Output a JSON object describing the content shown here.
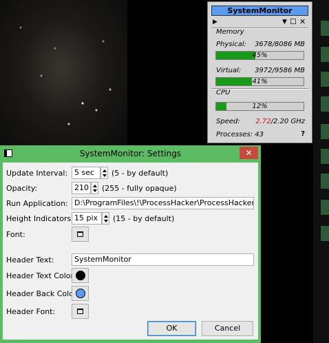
{
  "monitor": {
    "title": "SystemMonitor",
    "memory_section": "Memory",
    "physical_label": "Physical:",
    "physical_value": "3678/8086 MB",
    "physical_percent_label": "45%",
    "physical_percent": 0.45,
    "virtual_label": "Virtual:",
    "virtual_value": "3972/9586 MB",
    "virtual_percent_label": "41%",
    "virtual_percent": 0.41,
    "cpu_section": "CPU",
    "cpu_percent_label": "12%",
    "cpu_percent": 0.12,
    "speed_label": "Speed:",
    "speed_current": "2.72",
    "speed_max": "/2.20 GHz",
    "processes": "Processes: 43",
    "help": "?",
    "colors": {
      "header_back": "#5b9bef",
      "bar": "#1a9a1a",
      "speed": "#d01010"
    }
  },
  "dialog": {
    "title": "SystemMonitor: Settings",
    "close": "✕",
    "update_interval_label": "Update Interval:",
    "update_interval_value": "5 sec",
    "update_interval_hint": "(5 - by default)",
    "opacity_label": "Opacity:",
    "opacity_value": "210",
    "opacity_hint": "(255 - fully opaque)",
    "run_app_label": "Run Application:",
    "run_app_value": "D:\\ProgramFiles\\!\\ProcessHacker\\ProcessHacker.exe",
    "height_label": "Height Indicators:",
    "height_value": "15 pix",
    "height_hint": "(15 - by default)",
    "font_label": "Font:",
    "header_text_label": "Header Text:",
    "header_text_value": "SystemMonitor",
    "header_text_color_label": "Header Text Color:",
    "header_text_color": "#000000",
    "header_back_color_label": "Header Back Color:",
    "header_back_color": "#5b9bef",
    "header_font_label": "Header Font:",
    "ok": "OK",
    "cancel": "Cancel"
  }
}
